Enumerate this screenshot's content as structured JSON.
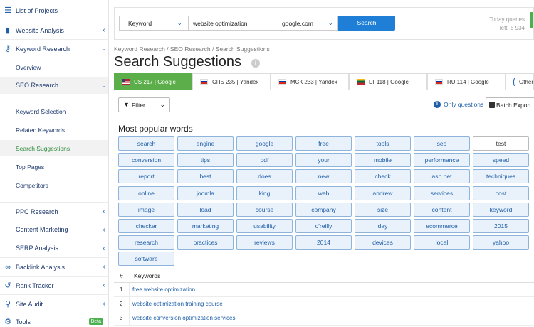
{
  "sidebar": {
    "projects": "List of Projects",
    "website_analysis": "Website Analysis",
    "keyword_research": "Keyword Research",
    "overview": "Overview",
    "seo_research": "SEO Research",
    "sub_items": [
      "Keyword Selection",
      "Related Keywords",
      "Search Suggestions",
      "Top Pages",
      "Competitors"
    ],
    "ppc_research": "PPC Research",
    "content_marketing": "Content Marketing",
    "serp_analysis": "SERP Analysis",
    "backlink_analysis": "Backlink Analysis",
    "rank_tracker": "Rank Tracker",
    "site_audit": "Site Audit",
    "tools": "Tools",
    "beta": "Beta"
  },
  "topbar": {
    "mode": "Keyword",
    "query": "website optimization",
    "database": "google.com",
    "search_label": "Search",
    "today_queries": "Today queries",
    "left": "left: 5 934"
  },
  "breadcrumb": "Keyword Research / SEO Research / Search Suggestions",
  "title": "Search Suggestions",
  "tabs": [
    {
      "label": "US 217 | Google",
      "flag": "us"
    },
    {
      "label": "СПБ 235 | Yandex",
      "flag": "ru"
    },
    {
      "label": "МСК 233 | Yandex",
      "flag": "ru"
    },
    {
      "label": "LT 118 | Google",
      "flag": "lt"
    },
    {
      "label": "RU 114 | Google",
      "flag": "ru"
    },
    {
      "label": "Other",
      "flag": "globe"
    }
  ],
  "toolbar": {
    "filter": "Filter",
    "only_questions": "Only questions",
    "batch_export": "Batch Export"
  },
  "popular": {
    "heading": "Most popular words",
    "words": [
      "search",
      "engine",
      "google",
      "free",
      "tools",
      "seo",
      "test",
      "conversion",
      "tips",
      "pdf",
      "your",
      "mobile",
      "performance",
      "speed",
      "report",
      "best",
      "does",
      "new",
      "check",
      "asp.net",
      "techniques",
      "online",
      "joomla",
      "king",
      "web",
      "andrew",
      "services",
      "cost",
      "image",
      "load",
      "course",
      "company",
      "size",
      "content",
      "keyword",
      "checker",
      "marketing",
      "usability",
      "o'reilly",
      "day",
      "ecommerce",
      "2015",
      "research",
      "practices",
      "reviews",
      "2014",
      "devices",
      "local",
      "yahoo",
      "software"
    ]
  },
  "table": {
    "col_num": "#",
    "col_kw": "Keywords",
    "rows": [
      {
        "n": "1",
        "kw": "free website optimization"
      },
      {
        "n": "2",
        "kw": "website optimization training course"
      },
      {
        "n": "3",
        "kw": "website conversion optimization services"
      }
    ]
  }
}
